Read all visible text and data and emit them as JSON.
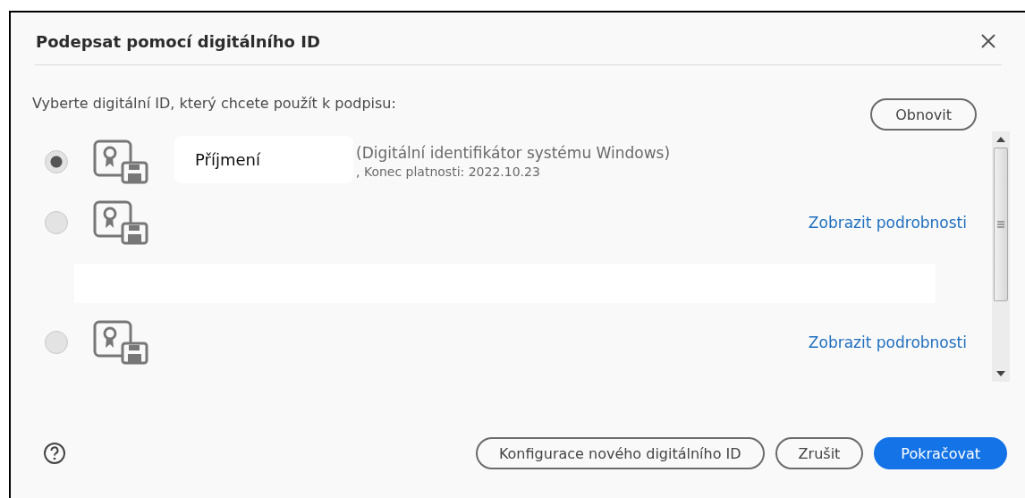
{
  "dialog": {
    "title": "Podepsat pomocí digitálního ID",
    "instruction": "Vyberte digitální ID, který chcete použít k podpisu:",
    "refresh_button": "Obnovit"
  },
  "ids": [
    {
      "kind": "id",
      "selected": true,
      "name_overlay": "Příjmení",
      "description": "(Digitální identifikátor systému Windows)",
      "expiry": ", Konec platnosti: 2022.10.23"
    },
    {
      "kind": "id",
      "selected": false,
      "details_link": "Zobrazit podrobnosti"
    },
    {
      "kind": "redacted"
    },
    {
      "kind": "id",
      "selected": false,
      "details_link": "Zobrazit podrobnosti"
    }
  ],
  "buttons": [
    {
      "label": "Konfigurace nového digitálního ID",
      "primary": false
    },
    {
      "label": "Zrušit",
      "primary": false
    },
    {
      "label": "Pokračovat",
      "primary": true
    }
  ]
}
